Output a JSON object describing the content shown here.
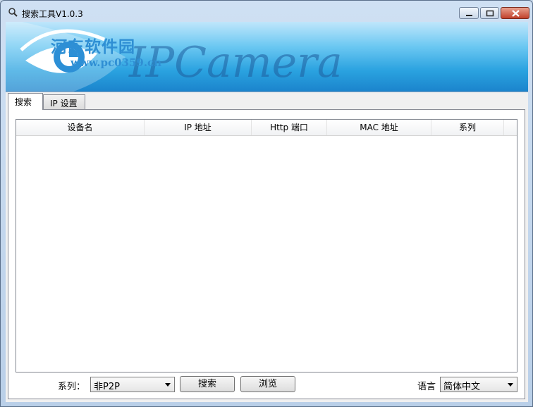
{
  "window": {
    "title": "搜索工具V1.0.3"
  },
  "banner": {
    "watermark": "河东软件园",
    "watermark_url": "www.pc0359.cn",
    "logo_text": "IPCamera"
  },
  "tabs": [
    {
      "label": "搜索",
      "active": true
    },
    {
      "label": "IP 设置",
      "active": false
    }
  ],
  "device_list": {
    "columns": [
      "设备名",
      "IP 地址",
      "Http 端口",
      "MAC 地址",
      "系列"
    ],
    "rows": []
  },
  "controls": {
    "series_label": "系列：",
    "series_value": "非P2P",
    "search_button": "搜索",
    "browse_button": "浏览",
    "language_label": "语言",
    "language_value": "简体中文"
  },
  "colors": {
    "banner_blue": "#2aa2e0",
    "close_red": "#c1412b"
  }
}
